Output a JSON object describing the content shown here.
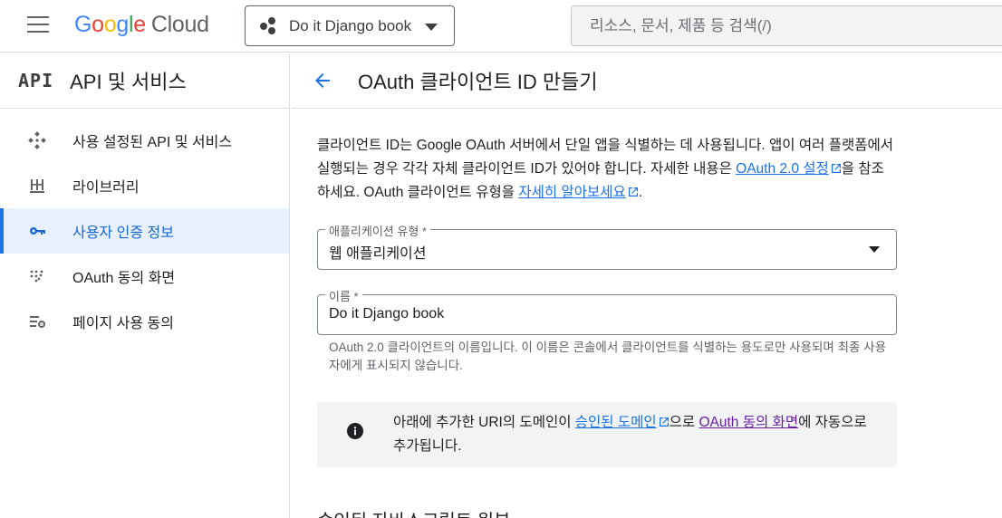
{
  "topbar": {
    "logo_letters": [
      "G",
      "o",
      "o",
      "g",
      "l",
      "e"
    ],
    "logo_product": "Cloud",
    "project_name": "Do it Django book",
    "search_placeholder": "리소스, 문서, 제품 등 검색(/)"
  },
  "sidebar": {
    "logo_text": "API",
    "title": "API 및 서비스",
    "items": [
      {
        "label": "사용 설정된 API 및 서비스",
        "icon": "diamond-dots-icon"
      },
      {
        "label": "라이브러리",
        "icon": "library-icon"
      },
      {
        "label": "사용자 인증 정보",
        "icon": "key-icon",
        "active": true
      },
      {
        "label": "OAuth 동의 화면",
        "icon": "oauth-dots-icon"
      },
      {
        "label": "페이지 사용 동의",
        "icon": "settings-list-icon"
      }
    ]
  },
  "main": {
    "title": "OAuth 클라이언트 ID 만들기",
    "desc_part1": "클라이언트 ID는 Google OAuth 서버에서 단일 앱을 식별하는 데 사용됩니다. 앱이 여러 플랫폼에서 실행되는 경우 각각 자체 클라이언트 ID가 있어야 합니다. 자세한 내용은 ",
    "desc_link1": "OAuth 2.0 설정",
    "desc_part2": "을 참조하세요. OAuth 클라이언트 유형을 ",
    "desc_link2": "자세히 알아보세요",
    "desc_part3": ".",
    "app_type_label": "애플리케이션 유형 *",
    "app_type_value": "웹 애플리케이션",
    "name_label": "이름 *",
    "name_value": "Do it Django book",
    "name_hint": "OAuth 2.0 클라이언트의 이름입니다. 이 이름은 콘솔에서 클라이언트를 식별하는 용도로만 사용되며 최종 사용자에게 표시되지 않습니다.",
    "info_part1": "아래에 추가한 URI의 도메인이 ",
    "info_link1": "승인된 도메인",
    "info_part2": "으로 ",
    "info_link2": "OAuth 동의 화면",
    "info_part3": "에 자동으로 추가됩니다.",
    "next_section_peek": "승인된 자바스크립트 원본"
  },
  "colors": {
    "accent": "#1a73e8",
    "active_bg": "#e8f0fe",
    "visited_link": "#681da8"
  }
}
